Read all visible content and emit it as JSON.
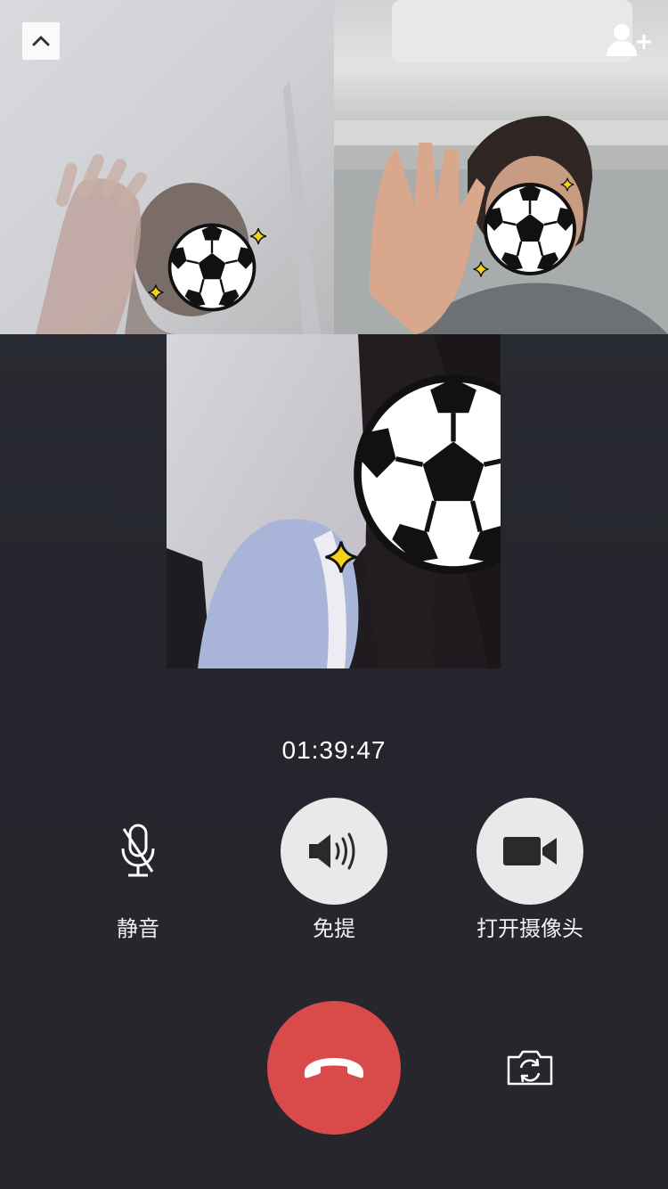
{
  "call": {
    "timer": "01:39:47"
  },
  "participants": [
    {
      "name": "participant-1",
      "sticker": "soccer-ball-sticker"
    },
    {
      "name": "participant-2",
      "sticker": "soccer-ball-sticker"
    },
    {
      "name": "participant-3",
      "sticker": "soccer-ball-sticker"
    }
  ],
  "controls": {
    "mute": {
      "label": "静音",
      "icon": "microphone-off-icon"
    },
    "speaker": {
      "label": "免提",
      "icon": "speaker-icon"
    },
    "camera": {
      "label": "打开摄像头",
      "icon": "video-camera-icon"
    },
    "hangup": {
      "icon": "hang-up-icon",
      "color": "#d94a4a"
    },
    "switch_camera": {
      "icon": "switch-camera-icon"
    }
  },
  "top_bar": {
    "collapse_icon": "chevron-up-icon",
    "add_icon": "add-user-icon"
  },
  "colors": {
    "background": "#2a2b32",
    "hangup": "#d94a4a",
    "control_fill": "#e9e9e9"
  }
}
